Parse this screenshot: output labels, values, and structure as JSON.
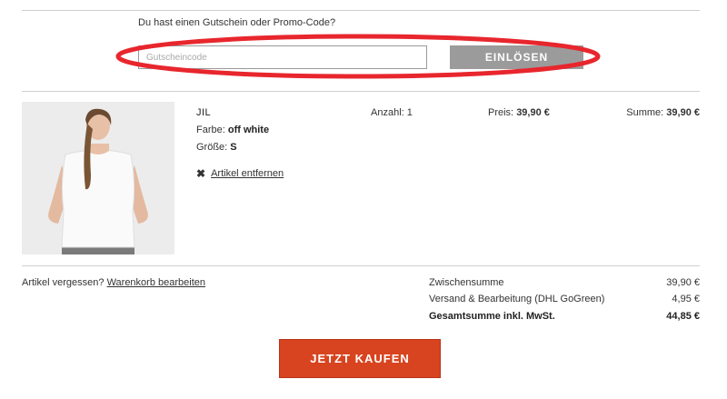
{
  "voucher": {
    "question": "Du hast einen Gutschein oder Promo-Code?",
    "placeholder": "Gutscheincode",
    "redeem_label": "EINLÖSEN"
  },
  "cart_item": {
    "name": "JIL",
    "color_label": "Farbe:",
    "color_value": "off white",
    "size_label": "Größe:",
    "size_value": "S",
    "remove_label": "Artikel entfernen",
    "qty_label": "Anzahl:",
    "qty_value": "1",
    "price_label": "Preis:",
    "price_value": "39,90 €",
    "sum_label": "Summe:",
    "sum_value": "39,90 €",
    "image_alt": "Frau im weißen T-Shirt"
  },
  "footer": {
    "forgot_text": "Artikel vergessen?",
    "edit_cart_link": "Warenkorb bearbeiten"
  },
  "totals": {
    "subtotal_label": "Zwischensumme",
    "subtotal_value": "39,90 €",
    "shipping_label": "Versand & Bearbeitung (DHL GoGreen)",
    "shipping_value": "4,95 €",
    "grand_label": "Gesamtsumme inkl. MwSt.",
    "grand_value": "44,85 €"
  },
  "buy_label": "JETZT KAUFEN",
  "colors": {
    "buy_button": "#d7441f",
    "redeem_button": "#9b9b9b",
    "highlight": "#e8262d"
  }
}
